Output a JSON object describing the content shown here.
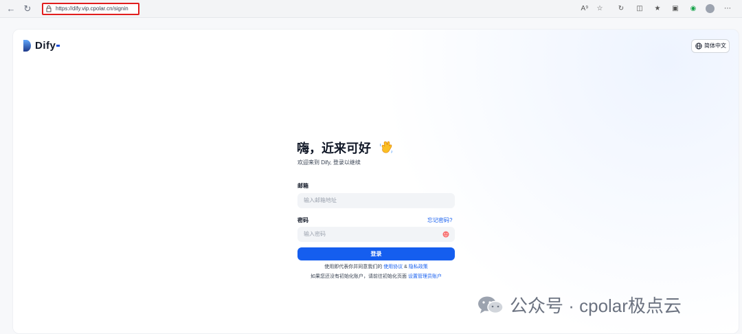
{
  "browser": {
    "url": "https://dify.vip.cpolar.cn/signin",
    "icons": [
      "back-icon",
      "reload-icon",
      "read-aloud-icon",
      "favorite-icon",
      "extensions-icon",
      "split-icon",
      "favorites-icon",
      "collections-icon",
      "shield-icon",
      "profile-icon"
    ]
  },
  "header": {
    "logo_text": "Dify",
    "language_label": "简体中文"
  },
  "signin": {
    "title": "嗨，近来可好",
    "subtitle": "欢迎来到 Dify, 登录以继续",
    "email_label": "邮箱",
    "email_placeholder": "输入邮箱地址",
    "password_label": "密码",
    "forgot_label": "忘记密码?",
    "password_placeholder": "输入密码",
    "submit_label": "登录",
    "terms_prefix": "使用即代表你并同意我们的 ",
    "terms_link": "使用协议",
    "terms_and": " & ",
    "privacy_link": "隐私政策",
    "init_prefix": "如果您还没有初始化账户，请前往初始化页面 ",
    "init_link": "设置管理员账户"
  },
  "watermark": {
    "text": "公众号 · cpolar极点云"
  },
  "colors": {
    "accent": "#155eef",
    "highlight_border": "#e11d1d"
  }
}
